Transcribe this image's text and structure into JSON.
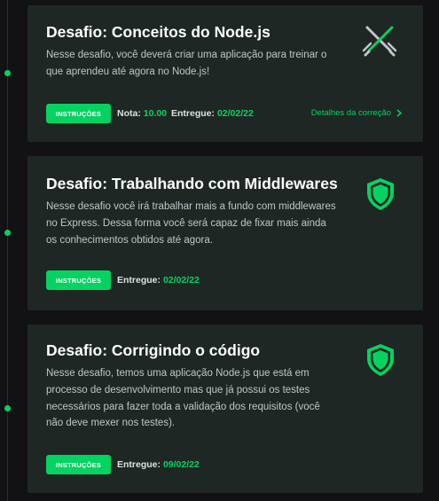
{
  "challenges": [
    {
      "title": "Desafio: Conceitos do Node.js",
      "description": "Nesse desafio, você deverá criar uma aplicação para treinar o que aprendeu até agora no Node.js!",
      "button_label": "INSTRUÇÕES",
      "grade_label": "Nota:",
      "grade_value": "10.00",
      "delivered_label": "Entregue:",
      "delivered_value": "02/02/22",
      "details_link": "Detalhes da correção",
      "icon": "crossed-swords-icon"
    },
    {
      "title": "Desafio: Trabalhando com Middlewares",
      "description": "Nesse desafio você irá trabalhar mais a fundo com middlewares no Express. Dessa forma você será capaz de fixar mais ainda os conhecimentos obtidos até agora.",
      "button_label": "INSTRUÇÕES",
      "delivered_label": "Entregue:",
      "delivered_value": "02/02/22",
      "icon": "shield-icon"
    },
    {
      "title": "Desafio: Corrigindo o código",
      "description": "Nesse desafio, temos uma aplicação Node.js que está em processo de desenvolvimento mas que já possui os testes necessários para fazer toda a validação dos requisitos (você não deve mexer nos testes).",
      "button_label": "INSTRUÇÕES",
      "delivered_label": "Entregue:",
      "delivered_value": "09/02/22",
      "icon": "shield-icon"
    }
  ],
  "colors": {
    "background": "#121214",
    "card": "#1e2723",
    "accent": "#04d361",
    "title": "#ffffff",
    "text": "#c4c4cc"
  }
}
